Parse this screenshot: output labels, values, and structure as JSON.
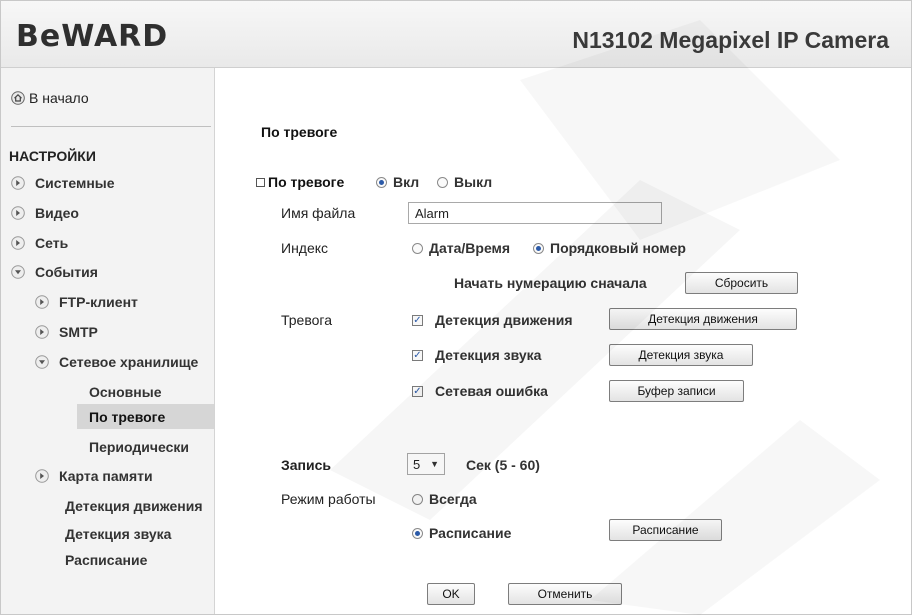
{
  "header": {
    "logo": "BeWARD",
    "camera_title": "N13102 Megapixel IP Camera"
  },
  "sidebar": {
    "home": "В начало",
    "section": "НАСТРОЙКИ",
    "items": [
      {
        "label": "Системные",
        "state": "collapsed"
      },
      {
        "label": "Видео",
        "state": "collapsed"
      },
      {
        "label": "Сеть",
        "state": "collapsed"
      },
      {
        "label": "События",
        "state": "expanded"
      },
      {
        "label": "FTP-клиент",
        "state": "collapsed"
      },
      {
        "label": "SMTP",
        "state": "collapsed"
      },
      {
        "label": "Сетевое хранилище",
        "state": "expanded"
      },
      {
        "label": "Основные"
      },
      {
        "label": "По тревоге",
        "selected": true
      },
      {
        "label": "Периодически"
      },
      {
        "label": "Карта памяти",
        "state": "collapsed"
      },
      {
        "label": "Детекция движения"
      },
      {
        "label": "Детекция звука"
      },
      {
        "label": "Расписание"
      }
    ]
  },
  "main": {
    "title": "По тревоге",
    "alarm_toggle": {
      "label": "По тревоге",
      "on_label": "Вкл",
      "off_label": "Выкл",
      "selected": "on"
    },
    "filename": {
      "label": "Имя файла",
      "value": "Alarm"
    },
    "index": {
      "label": "Индекс",
      "option1": "Дата/Время",
      "option2": "Порядковый номер",
      "selected": "option2"
    },
    "restart": {
      "label": "Начать нумерацию сначала",
      "button": "Сбросить"
    },
    "alarm": {
      "label": "Тревога",
      "checks": [
        {
          "label": "Детекция движения",
          "checked": true,
          "button": "Детекция движения"
        },
        {
          "label": "Детекция звука",
          "checked": true,
          "button": "Детекция звука"
        },
        {
          "label": "Сетевая ошибка",
          "checked": true,
          "button": "Буфер записи"
        }
      ]
    },
    "record": {
      "label": "Запись",
      "value": "5",
      "unit": "Сек (5 - 60)"
    },
    "mode": {
      "label": "Режим работы",
      "option1": "Всегда",
      "option2": "Расписание",
      "selected": "option2",
      "button": "Расписание"
    },
    "actions": {
      "ok": "OK",
      "cancel": "Отменить"
    }
  },
  "colors": {
    "accent": "#2b5aa8",
    "sidebar_bg": "#f3f3f3",
    "selected_bg": "#d6d6d6"
  }
}
